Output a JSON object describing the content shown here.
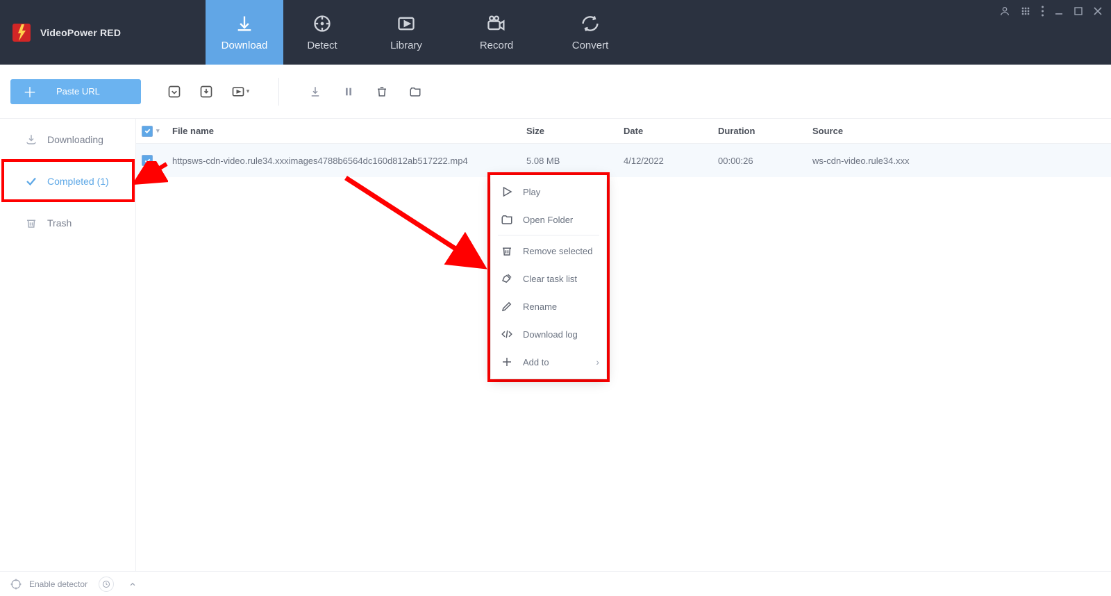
{
  "app": {
    "name": "VideoPower RED"
  },
  "nav": {
    "download": "Download",
    "detect": "Detect",
    "library": "Library",
    "record": "Record",
    "convert": "Convert"
  },
  "toolbar": {
    "paste_url": "Paste URL"
  },
  "sidebar": {
    "downloading": "Downloading",
    "completed": "Completed (1)",
    "trash": "Trash"
  },
  "columns": {
    "name": "File name",
    "size": "Size",
    "date": "Date",
    "duration": "Duration",
    "source": "Source"
  },
  "rows": [
    {
      "name": "httpsws-cdn-video.rule34.xxximages4788b6564dc160d812ab517222.mp4",
      "size": "5.08 MB",
      "date": "4/12/2022",
      "duration": "00:00:26",
      "source": "ws-cdn-video.rule34.xxx"
    }
  ],
  "context_menu": {
    "play": "Play",
    "open_folder": "Open Folder",
    "remove_selected": "Remove selected",
    "clear_task_list": "Clear task list",
    "rename": "Rename",
    "download_log": "Download log",
    "add_to": "Add to"
  },
  "bottom": {
    "enable_detector": "Enable detector"
  }
}
